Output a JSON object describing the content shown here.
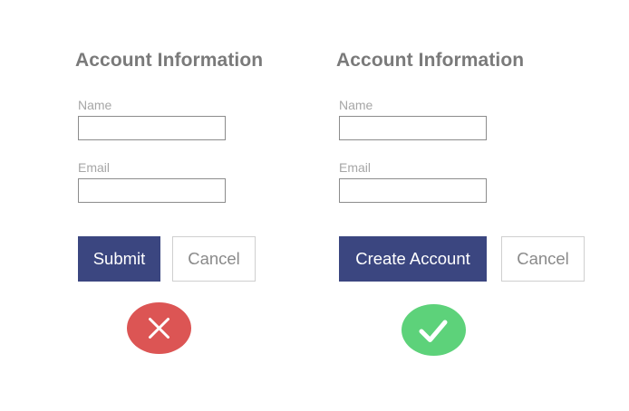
{
  "bad_example": {
    "heading": "Account Information",
    "name_label": "Name",
    "name_value": "",
    "email_label": "Email",
    "email_value": "",
    "primary_button_label": "Submit",
    "secondary_button_label": "Cancel",
    "verdict_icon": "x-icon",
    "verdict_color": "#dc5554"
  },
  "good_example": {
    "heading": "Account Information",
    "name_label": "Name",
    "name_value": "",
    "email_label": "Email",
    "email_value": "",
    "primary_button_label": "Create Account",
    "secondary_button_label": "Cancel",
    "verdict_icon": "checkmark-icon",
    "verdict_color": "#5dd27a"
  },
  "colors": {
    "primary_button": "#3b4680",
    "heading_text": "#7a7a7a",
    "label_text": "#a6a6a6"
  }
}
